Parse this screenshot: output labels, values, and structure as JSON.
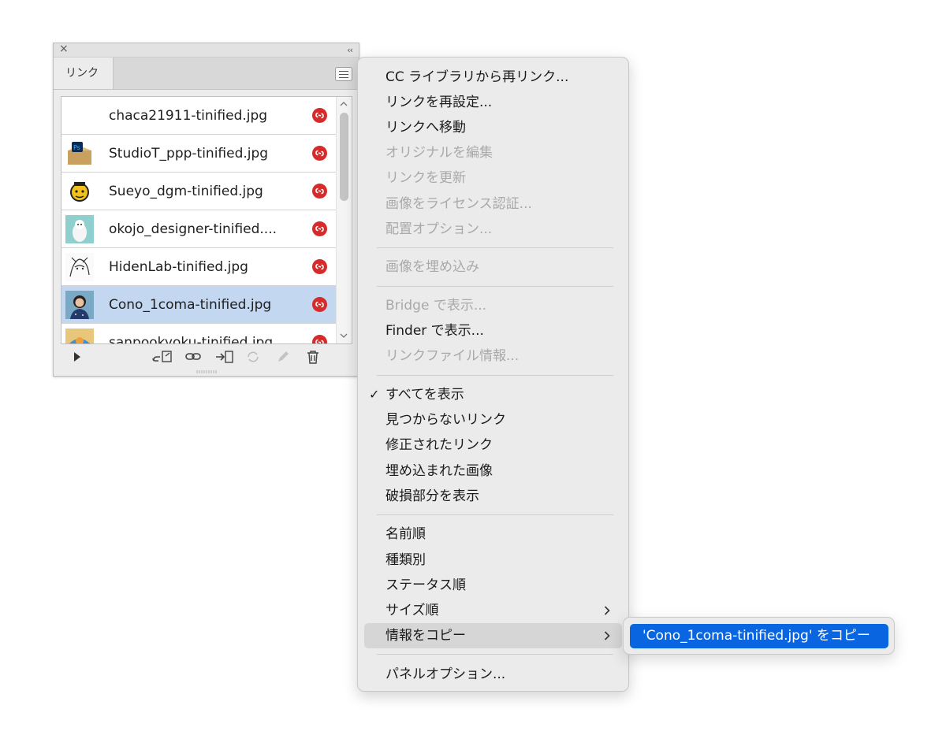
{
  "panel": {
    "tab_label": "リンク",
    "close_glyph": "×",
    "collapse_glyph": "‹‹",
    "files": [
      {
        "name": "chaca21911-tinified.jpg",
        "selected": false,
        "thumb": "none"
      },
      {
        "name": "StudioT_ppp-tinified.jpg",
        "selected": false,
        "thumb": "ps-box"
      },
      {
        "name": "Sueyo_dgm-tinified.jpg",
        "selected": false,
        "thumb": "face"
      },
      {
        "name": "okojo_designer-tinified....",
        "selected": false,
        "thumb": "ermine"
      },
      {
        "name": "HidenLab-tinified.jpg",
        "selected": false,
        "thumb": "sketch"
      },
      {
        "name": "Cono_1coma-tinified.jpg",
        "selected": true,
        "thumb": "portrait"
      },
      {
        "name": "sanpookyoku-tinified.jpg",
        "selected": false,
        "thumb": "illustration"
      }
    ],
    "status_icon": "missing-link-icon",
    "status_color": "#d52b2b",
    "footer_icons": [
      "play-icon",
      "relink-cc-icon",
      "link-icon",
      "goto-link-icon",
      "update-link-icon",
      "edit-original-icon",
      "trash-icon"
    ]
  },
  "menu": {
    "items": [
      {
        "label": "CC ライブラリから再リンク...",
        "enabled": true
      },
      {
        "label": "リンクを再設定...",
        "enabled": true
      },
      {
        "label": "リンクへ移動",
        "enabled": true
      },
      {
        "label": "オリジナルを編集",
        "enabled": false
      },
      {
        "label": "リンクを更新",
        "enabled": false
      },
      {
        "label": "画像をライセンス認証...",
        "enabled": false
      },
      {
        "label": "配置オプション...",
        "enabled": false
      },
      {
        "label": "画像を埋め込み",
        "enabled": false
      },
      {
        "label": "Bridge で表示...",
        "enabled": false
      },
      {
        "label": "Finder で表示...",
        "enabled": true
      },
      {
        "label": "リンクファイル情報...",
        "enabled": false
      },
      {
        "label": "すべてを表示",
        "enabled": true,
        "checked": true
      },
      {
        "label": "見つからないリンク",
        "enabled": true
      },
      {
        "label": "修正されたリンク",
        "enabled": true
      },
      {
        "label": "埋め込まれた画像",
        "enabled": true
      },
      {
        "label": "破損部分を表示",
        "enabled": true
      },
      {
        "label": "名前順",
        "enabled": true
      },
      {
        "label": "種類別",
        "enabled": true
      },
      {
        "label": "ステータス順",
        "enabled": true
      },
      {
        "label": "サイズ順",
        "enabled": true,
        "submenu": true
      },
      {
        "label": "情報をコピー",
        "enabled": true,
        "submenu": true,
        "highlighted": true
      },
      {
        "label": "パネルオプション...",
        "enabled": true
      }
    ],
    "check_glyph": "✓"
  },
  "submenu": {
    "item_label": "'Cono_1coma-tinified.jpg' をコピー",
    "accent_color": "#0a66e0"
  }
}
